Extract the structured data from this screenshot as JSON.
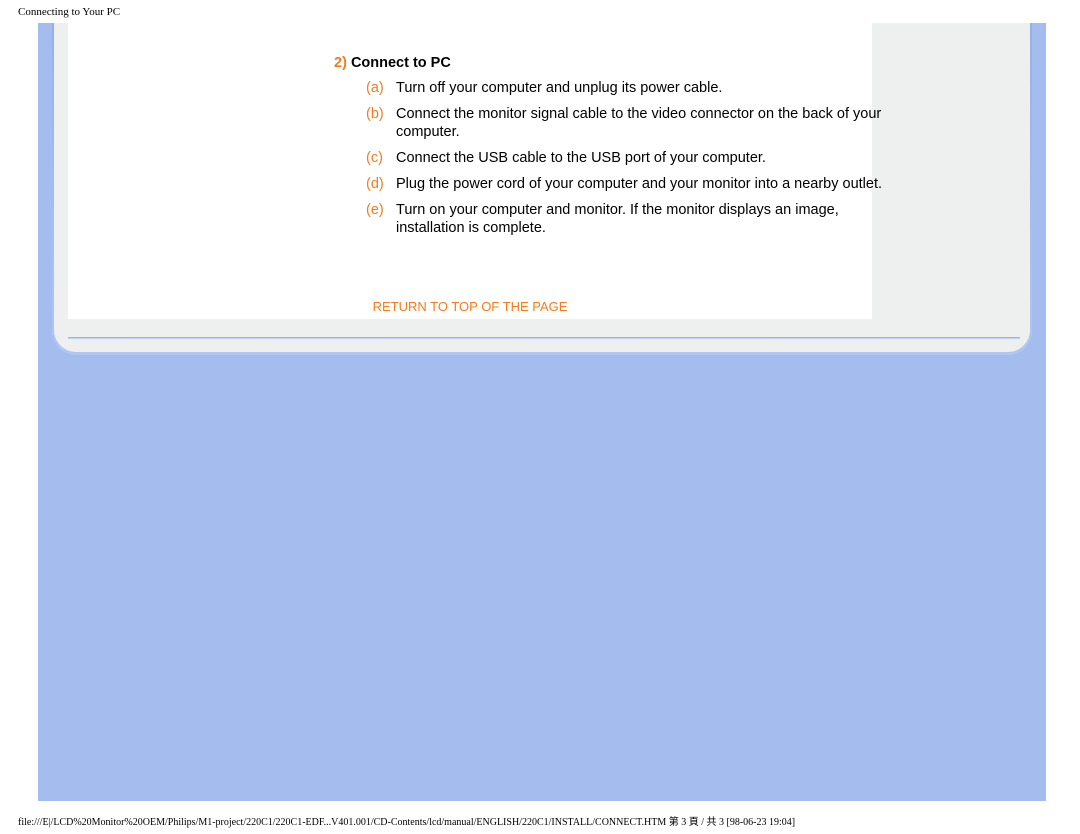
{
  "header": {
    "title": "Connecting to Your PC"
  },
  "step": {
    "number": "2)",
    "title": "Connect to PC",
    "items": [
      {
        "letter": "(a)",
        "text": "Turn off your computer and unplug its power cable."
      },
      {
        "letter": "(b)",
        "text": "Connect the monitor signal cable to the video connector on the back of your computer."
      },
      {
        "letter": "(c)",
        "text": "Connect the USB cable to the USB port of your computer."
      },
      {
        "letter": "(d)",
        "text": "Plug the power cord of your computer and your monitor into a nearby outlet."
      },
      {
        "letter": "(e)",
        "text": "Turn on your computer and monitor. If the monitor displays an image, installation is complete."
      }
    ]
  },
  "return_link": "RETURN TO TOP OF THE PAGE",
  "footer": "file:///E|/LCD%20Monitor%20OEM/Philips/M1-project/220C1/220C1-EDF...V401.001/CD-Contents/lcd/manual/ENGLISH/220C1/INSTALL/CONNECT.HTM 第 3 頁 / 共 3  [98-06-23 19:04]"
}
